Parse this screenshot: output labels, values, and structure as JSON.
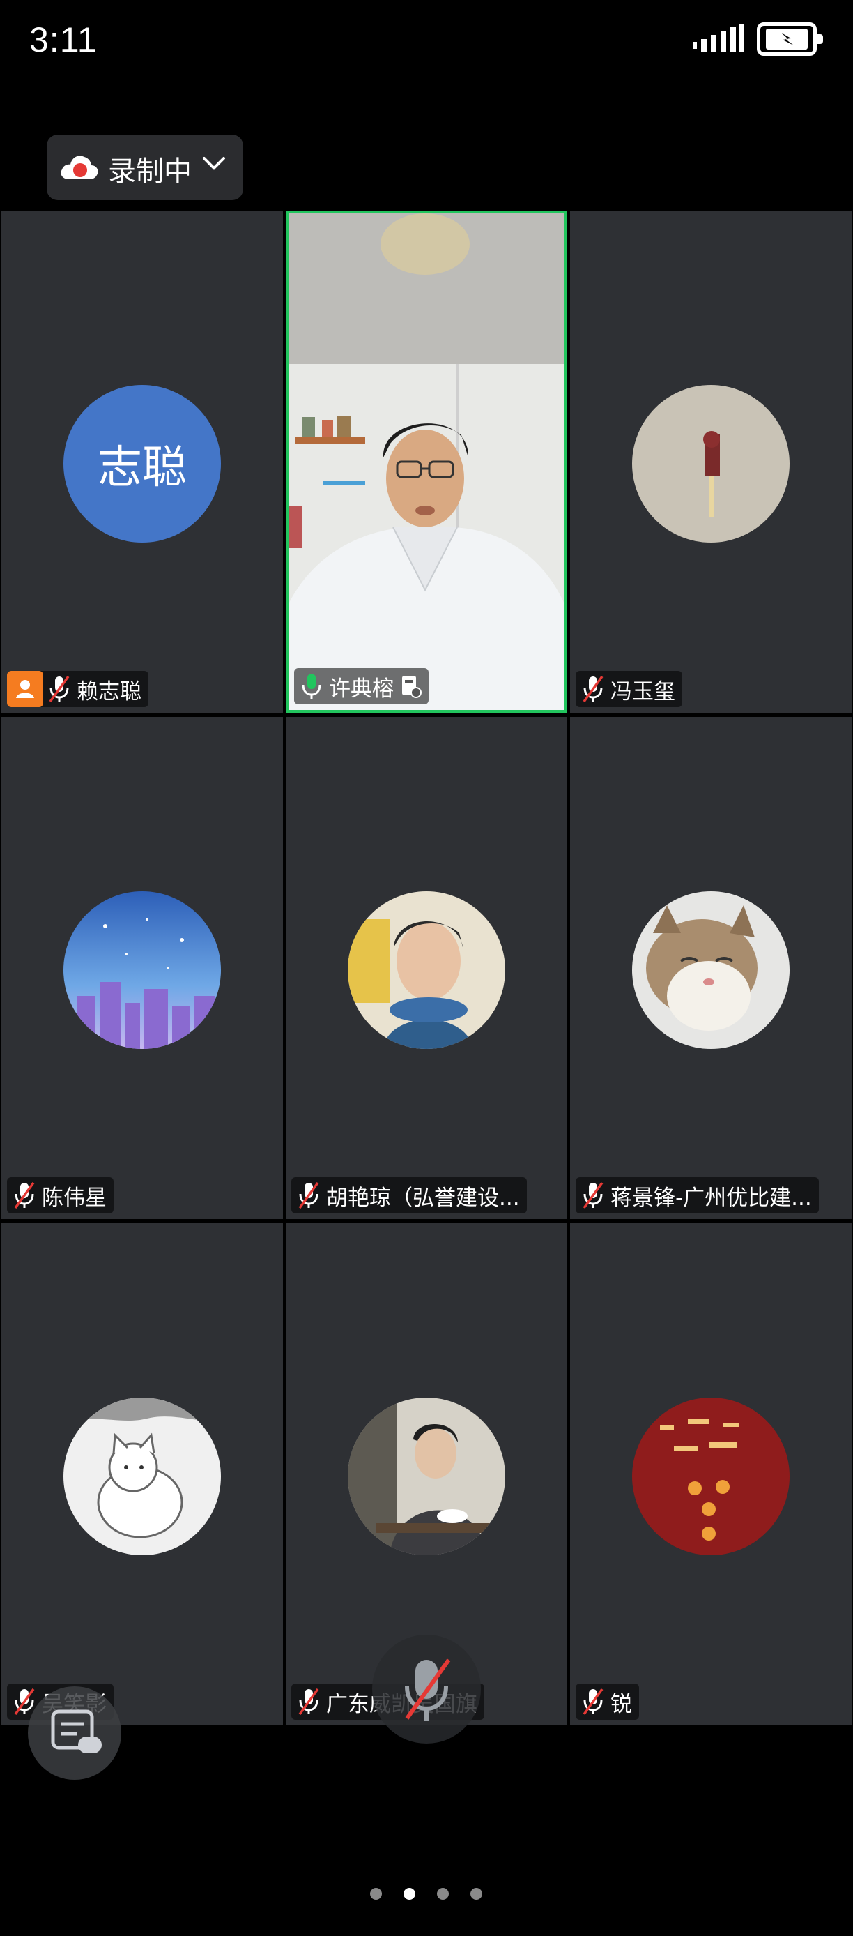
{
  "status_bar": {
    "time": "3:11"
  },
  "recording": {
    "label": "录制中"
  },
  "participants": [
    {
      "name": "赖志聪",
      "initials": "志聪",
      "avatar": "initials",
      "mic": "muted",
      "host": true
    },
    {
      "name": "许典榕",
      "avatar": "video",
      "mic": "speaking",
      "active": true
    },
    {
      "name": "冯玉玺",
      "avatar": "iron-man-photo",
      "mic": "muted"
    },
    {
      "name": "陈伟星",
      "avatar": "starry-city-illustration",
      "mic": "muted"
    },
    {
      "name": "胡艳琼（弘誉建设...",
      "avatar": "woman-photo",
      "mic": "muted"
    },
    {
      "name": "蒋景锋-广州优比建...",
      "avatar": "cat-photo",
      "mic": "muted"
    },
    {
      "name": "吴笑影",
      "avatar": "white-cat-drawing",
      "mic": "muted"
    },
    {
      "name": "广东威凯吴国旗",
      "avatar": "man-tea-photo",
      "mic": "muted"
    },
    {
      "name": "锐",
      "avatar": "red-calligraphy-art",
      "mic": "muted"
    }
  ],
  "pager": {
    "pages": 4,
    "current": 2
  },
  "colors": {
    "active_border": "#22c55e",
    "host_badge": "#f57c20",
    "initials_bg": "#4476c8",
    "record_red": "#e53935"
  }
}
